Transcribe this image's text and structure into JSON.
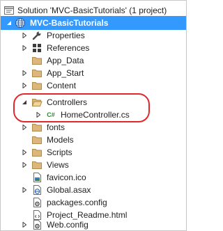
{
  "solution_explorer": {
    "solution_label": "Solution 'MVC-BasicTutorials' (1 project)",
    "project_label": "MVC-BasicTutorials",
    "items": [
      {
        "label": "Properties"
      },
      {
        "label": "References"
      },
      {
        "label": "App_Data"
      },
      {
        "label": "App_Start"
      },
      {
        "label": "Content"
      },
      {
        "label": "Controllers"
      },
      {
        "label": "HomeController.cs"
      },
      {
        "label": "fonts"
      },
      {
        "label": "Models"
      },
      {
        "label": "Scripts"
      },
      {
        "label": "Views"
      },
      {
        "label": "favicon.ico"
      },
      {
        "label": "Global.asax"
      },
      {
        "label": "packages.config"
      },
      {
        "label": "Project_Readme.html"
      },
      {
        "label": "Web.config"
      }
    ],
    "csharp_badge": "C#"
  },
  "colors": {
    "selection": "#3399ff",
    "folder": "#dcb67a",
    "highlight_ring": "#e0282c"
  }
}
